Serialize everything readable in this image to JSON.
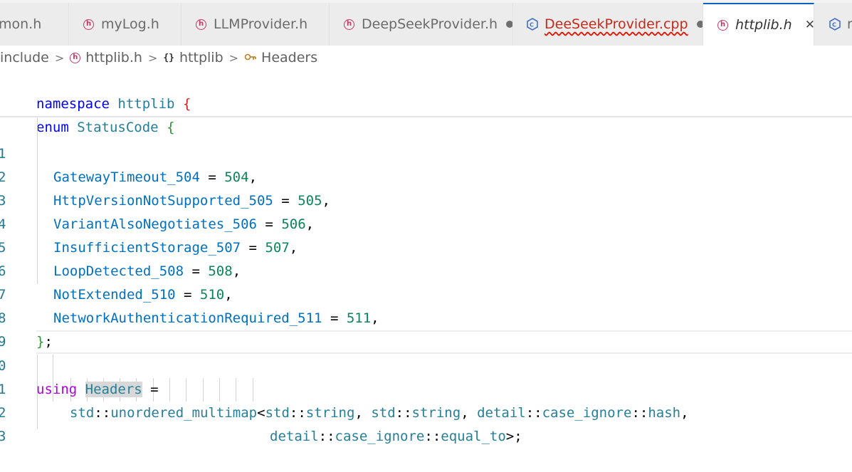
{
  "tabs": [
    {
      "label": "mon.h",
      "icon": "header-file-icon",
      "modified": false
    },
    {
      "label": "myLog.h",
      "icon": "header-file-icon",
      "modified": false
    },
    {
      "label": "LLMProvider.h",
      "icon": "header-file-icon",
      "modified": false
    },
    {
      "label": "DeepSeekProvider.h",
      "icon": "header-file-icon",
      "modified": true
    },
    {
      "label": "DeeSeekProvider.cpp",
      "icon": "cpp-file-icon",
      "modified": true,
      "error": true
    },
    {
      "label": "httplib.h",
      "icon": "header-file-icon",
      "active": true,
      "close": "✕"
    },
    {
      "label": "r",
      "icon": "cpp-file-icon"
    }
  ],
  "breadcrumb": {
    "items": [
      "include",
      "httplib.h",
      "httplib",
      "Headers"
    ],
    "separator": ">"
  },
  "sticky": {
    "line1": {
      "keyword": "namespace",
      "name": "httplib",
      "brace": "{"
    },
    "line2": {
      "keyword": "enum",
      "name": "StatusCode",
      "brace": "{"
    }
  },
  "lines": [
    {
      "num": "1",
      "name": "GatewayTimeout_504",
      "eq": " = ",
      "value": "504",
      "punct": ","
    },
    {
      "num": "2",
      "name": "HttpVersionNotSupported_505",
      "eq": " = ",
      "value": "505",
      "punct": ","
    },
    {
      "num": "3",
      "name": "VariantAlsoNegotiates_506",
      "eq": " = ",
      "value": "506",
      "punct": ","
    },
    {
      "num": "4",
      "name": "InsufficientStorage_507",
      "eq": " = ",
      "value": "507",
      "punct": ","
    },
    {
      "num": "5",
      "name": "LoopDetected_508",
      "eq": " = ",
      "value": "508",
      "punct": ","
    },
    {
      "num": "6",
      "name": "NotExtended_510",
      "eq": " = ",
      "value": "510",
      "punct": ","
    },
    {
      "num": "7",
      "name": "NetworkAuthenticationRequired_511",
      "eq": " = ",
      "value": "511",
      "punct": ","
    }
  ],
  "line8": {
    "num": "8",
    "brace": "}",
    "semi": ";"
  },
  "line9": {
    "num": "9"
  },
  "line10": {
    "num": "0",
    "keyword": "using",
    "name": "Headers",
    "eq": " ="
  },
  "line11": {
    "num": "1",
    "std1": "std",
    "sep": "::",
    "multimap": "unordered_multimap",
    "lt": "<",
    "std2": "std",
    "string1": "string",
    "comma": ", ",
    "std3": "std",
    "string2": "string",
    "detail1": "detail",
    "ci1": "case_ignore",
    "hash": "hash",
    "trail": ","
  },
  "line12": {
    "num": "2",
    "detail2": "detail",
    "ci2": "case_ignore",
    "equal_to": "equal_to",
    "gt": ">",
    "semi": ";"
  },
  "line13": {
    "num": "3"
  },
  "colors": {
    "keyword": "#0000ff",
    "type": "#267f99",
    "enum_member": "#0070c1",
    "number": "#098658",
    "accent": "#0a62c9",
    "error": "#e51400"
  }
}
